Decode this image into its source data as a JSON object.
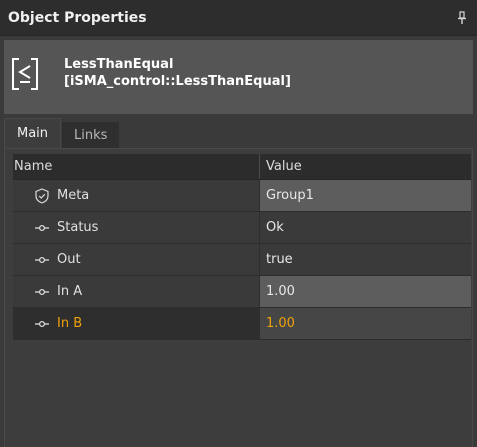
{
  "window": {
    "title": "Object Properties",
    "pin_icon": "pin-icon"
  },
  "object": {
    "name": "LessThanEqual",
    "type": "[iSMA_control::LessThanEqual]",
    "icon": "less-than-equal-icon"
  },
  "tabs": [
    {
      "label": "Main",
      "active": true
    },
    {
      "label": "Links",
      "active": false
    }
  ],
  "grid": {
    "columns": [
      "Name",
      "Value"
    ],
    "rows": [
      {
        "icon": "shield-icon",
        "name": "Meta",
        "value": "Group1",
        "editable": true
      },
      {
        "icon": "slot-icon",
        "name": "Status",
        "value": "Ok",
        "editable": false
      },
      {
        "icon": "slot-icon",
        "name": "Out",
        "value": "true",
        "editable": false
      },
      {
        "icon": "slot-icon",
        "name": "In A",
        "value": "1.00",
        "editable": true
      },
      {
        "icon": "slot-icon",
        "name": "In B",
        "value": "1.00",
        "editable": true,
        "selected": true
      }
    ]
  },
  "colors": {
    "selected_text": "#f0a10a",
    "header_bg": "#555555"
  }
}
